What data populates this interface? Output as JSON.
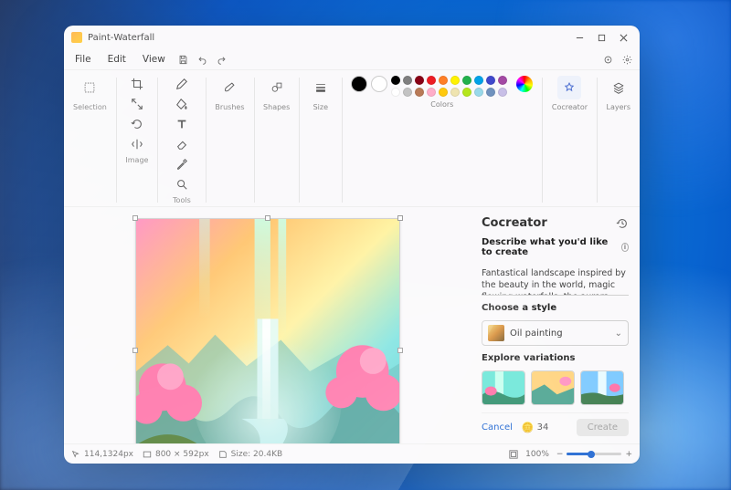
{
  "window": {
    "app_name": "Paint",
    "document_name": "Waterfall",
    "title_sep": " - "
  },
  "menubar": {
    "file": "File",
    "edit": "Edit",
    "view": "View"
  },
  "ribbon": {
    "selection": "Selection",
    "image": "Image",
    "tools": "Tools",
    "brushes": "Brushes",
    "shapes": "Shapes",
    "size": "Size",
    "colors": "Colors",
    "cocreator": "Cocreator",
    "layers": "Layers"
  },
  "palette_colors_row1": [
    "#000000",
    "#7f7f7f",
    "#880015",
    "#ed1c24",
    "#ff7f27",
    "#fff200",
    "#22b14c",
    "#00a2e8",
    "#3f48cc",
    "#a349a4"
  ],
  "palette_colors_row2": [
    "#ffffff",
    "#c3c3c3",
    "#b97a57",
    "#ffaec9",
    "#ffc90e",
    "#efe4b0",
    "#b5e61d",
    "#99d9ea",
    "#7092be",
    "#c8bfe7"
  ],
  "cocreator": {
    "title": "Cocreator",
    "describe_label": "Describe what you'd like to create",
    "prompt_value": "Fantastical landscape inspired by the beauty in the world, magic flowing waterfalls, the aurora borealis, tall trees, flowers, plants and a pink, yellow and blue sky.",
    "style_label": "Choose a style",
    "style_value": "Oil painting",
    "explore_label": "Explore variations",
    "cancel": "Cancel",
    "credits": "34",
    "generate": "Create"
  },
  "status": {
    "cursor": "114,1324px",
    "canvas_size": "800 × 592px",
    "file_size": "Size: 20.4KB",
    "zoom": "100%"
  }
}
